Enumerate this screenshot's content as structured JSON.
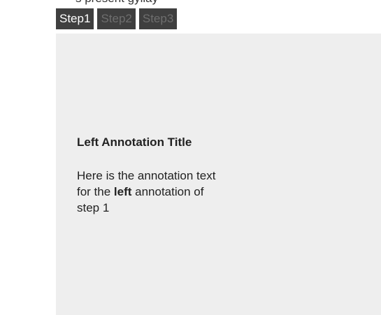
{
  "header": {
    "clipped_text": "s present gyllay"
  },
  "steps": {
    "tabs": [
      {
        "label": "Step1",
        "state": "active"
      },
      {
        "label": "Step2",
        "state": "inactive"
      },
      {
        "label": "Step3",
        "state": "inactive"
      }
    ]
  },
  "annotation": {
    "title": "Left Annotation Title",
    "body_part1": "Here is the annotation text for the ",
    "body_bold": "left",
    "body_part2": " annotation of step 1"
  },
  "colors": {
    "tab_background": "#3f3f3f",
    "tab_active_text": "#ffffff",
    "tab_inactive_text": "#6e6e6e",
    "panel_background": "#eeeeee"
  }
}
